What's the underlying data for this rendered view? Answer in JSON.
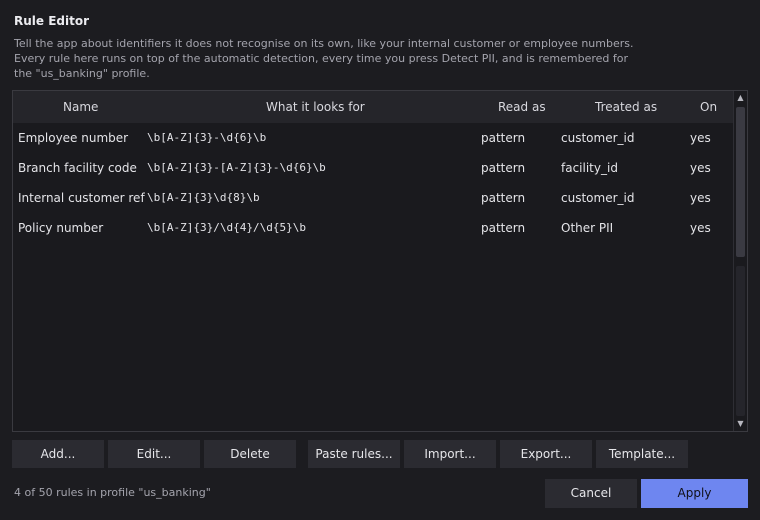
{
  "dialog": {
    "title": "Rule Editor",
    "description_lines": [
      "Tell the app about identifiers it does not recognise on its own, like your internal customer or employee numbers.",
      "Every rule here runs on top of the automatic detection, every time you press Detect PII, and is remembered for",
      "the \"us_banking\" profile."
    ]
  },
  "table": {
    "columns": [
      "Name",
      "What it looks for",
      "Read as",
      "Treated as",
      "On"
    ],
    "rows": [
      {
        "name": "Employee number",
        "pattern": "\\b[A-Z]{3}-\\d{6}\\b",
        "read_as": "pattern",
        "treated_as": "customer_id",
        "on": "yes"
      },
      {
        "name": "Branch facility code",
        "pattern": "\\b[A-Z]{3}-[A-Z]{3}-\\d{6}\\b",
        "read_as": "pattern",
        "treated_as": "facility_id",
        "on": "yes"
      },
      {
        "name": "Internal customer ref",
        "pattern": "\\b[A-Z]{3}\\d{8}\\b",
        "read_as": "pattern",
        "treated_as": "customer_id",
        "on": "yes"
      },
      {
        "name": "Policy number",
        "pattern": "\\b[A-Z]{3}/\\d{4}/\\d{5}\\b",
        "read_as": "pattern",
        "treated_as": "Other PII",
        "on": "yes"
      }
    ]
  },
  "buttons": {
    "add": "Add...",
    "edit": "Edit...",
    "delete": "Delete",
    "paste": "Paste rules...",
    "import": "Import...",
    "export": "Export...",
    "template": "Template...",
    "cancel": "Cancel",
    "apply": "Apply"
  },
  "status": "4 of 50 rules in profile \"us_banking\"",
  "icons": {
    "scroll_up": "chevron-up-icon",
    "scroll_down": "chevron-down-icon"
  },
  "colors": {
    "accent": "#6e86f0",
    "background": "#1c1c20"
  }
}
